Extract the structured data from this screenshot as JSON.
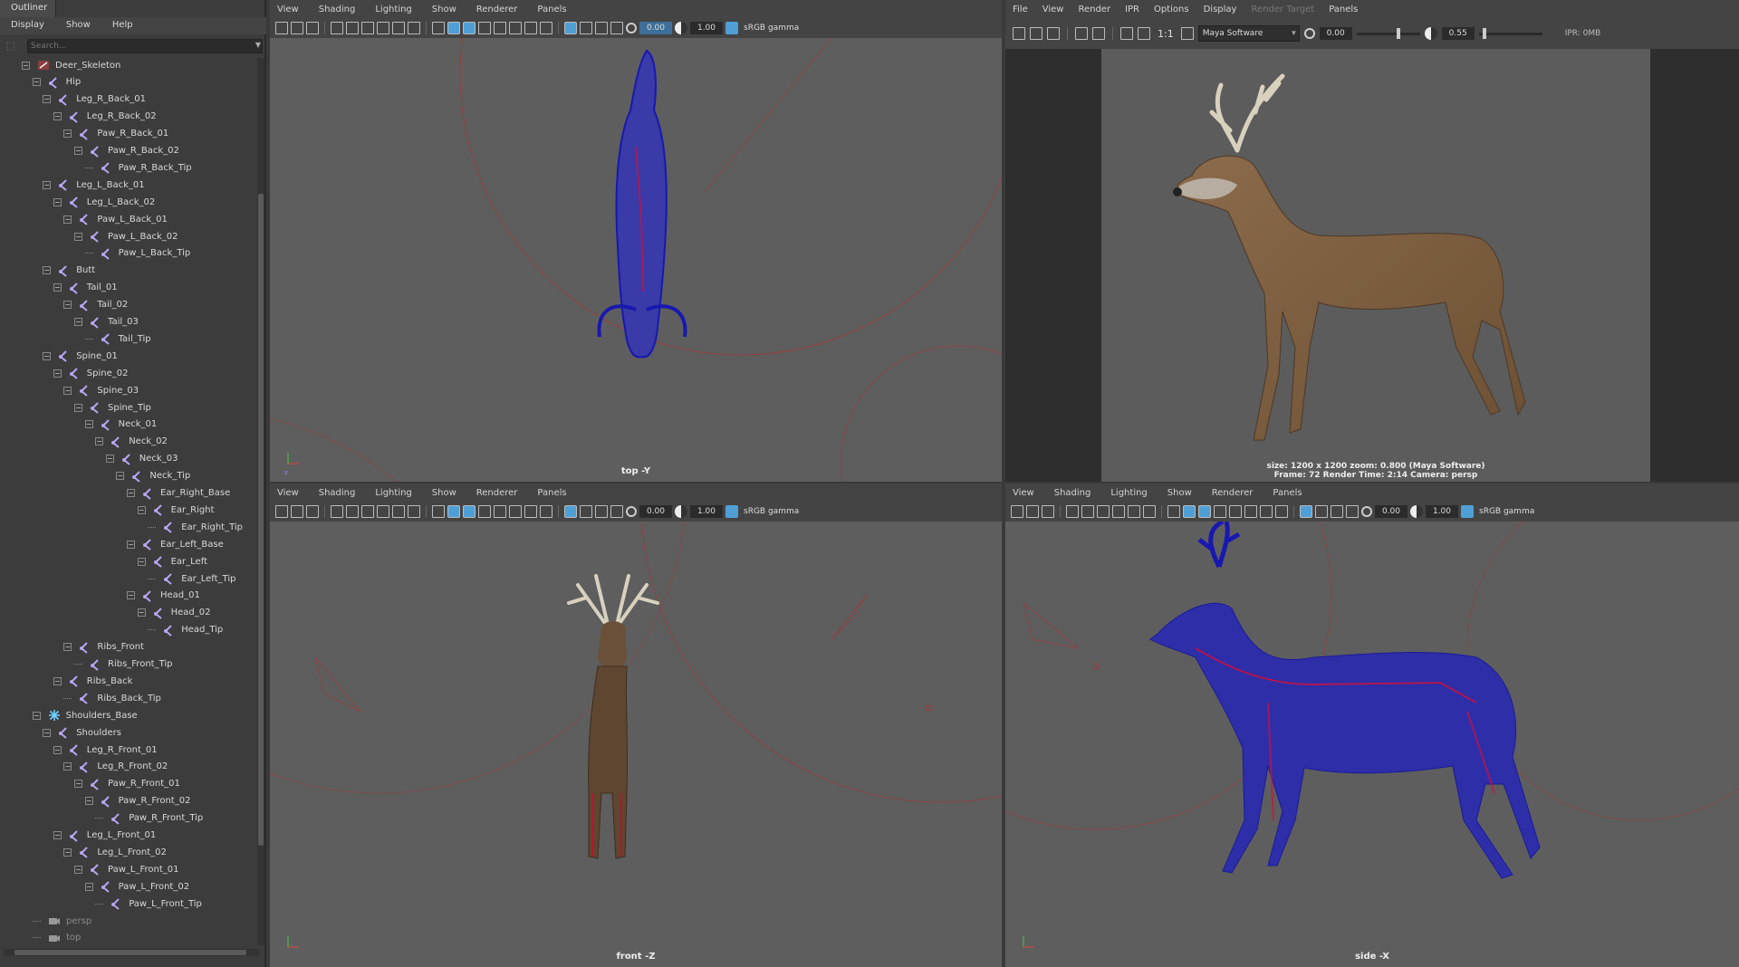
{
  "outliner": {
    "tab": "Outliner",
    "menu": [
      "Display",
      "Show",
      "Help"
    ],
    "search_placeholder": "Search...",
    "items": [
      {
        "label": "Deer_Skeleton",
        "depth": 0,
        "expander": "⊟",
        "icon": "group-icon"
      },
      {
        "label": "Hip",
        "depth": 1,
        "expander": "⊟",
        "icon": "joint-icon"
      },
      {
        "label": "Leg_R_Back_01",
        "depth": 2,
        "expander": "⊟",
        "icon": "joint-icon"
      },
      {
        "label": "Leg_R_Back_02",
        "depth": 3,
        "expander": "⊟",
        "icon": "joint-icon"
      },
      {
        "label": "Paw_R_Back_01",
        "depth": 4,
        "expander": "⊟",
        "icon": "joint-icon"
      },
      {
        "label": "Paw_R_Back_02",
        "depth": 5,
        "expander": "⊟",
        "icon": "joint-icon"
      },
      {
        "label": "Paw_R_Back_Tip",
        "depth": 6,
        "expander": "",
        "icon": "joint-icon"
      },
      {
        "label": "Leg_L_Back_01",
        "depth": 2,
        "expander": "⊟",
        "icon": "joint-icon"
      },
      {
        "label": "Leg_L_Back_02",
        "depth": 3,
        "expander": "⊟",
        "icon": "joint-icon"
      },
      {
        "label": "Paw_L_Back_01",
        "depth": 4,
        "expander": "⊟",
        "icon": "joint-icon"
      },
      {
        "label": "Paw_L_Back_02",
        "depth": 5,
        "expander": "⊟",
        "icon": "joint-icon"
      },
      {
        "label": "Paw_L_Back_Tip",
        "depth": 6,
        "expander": "",
        "icon": "joint-icon"
      },
      {
        "label": "Butt",
        "depth": 2,
        "expander": "⊟",
        "icon": "joint-icon"
      },
      {
        "label": "Tail_01",
        "depth": 3,
        "expander": "⊟",
        "icon": "joint-icon"
      },
      {
        "label": "Tail_02",
        "depth": 4,
        "expander": "⊟",
        "icon": "joint-icon"
      },
      {
        "label": "Tail_03",
        "depth": 5,
        "expander": "⊟",
        "icon": "joint-icon"
      },
      {
        "label": "Tail_Tip",
        "depth": 6,
        "expander": "",
        "icon": "joint-icon"
      },
      {
        "label": "Spine_01",
        "depth": 2,
        "expander": "⊟",
        "icon": "joint-icon"
      },
      {
        "label": "Spine_02",
        "depth": 3,
        "expander": "⊟",
        "icon": "joint-icon"
      },
      {
        "label": "Spine_03",
        "depth": 4,
        "expander": "⊟",
        "icon": "joint-icon"
      },
      {
        "label": "Spine_Tip",
        "depth": 5,
        "expander": "⊟",
        "icon": "joint-icon"
      },
      {
        "label": "Neck_01",
        "depth": 6,
        "expander": "⊟",
        "icon": "joint-icon"
      },
      {
        "label": "Neck_02",
        "depth": 7,
        "expander": "⊟",
        "icon": "joint-icon"
      },
      {
        "label": "Neck_03",
        "depth": 8,
        "expander": "⊟",
        "icon": "joint-icon"
      },
      {
        "label": "Neck_Tip",
        "depth": 9,
        "expander": "⊟",
        "icon": "joint-icon"
      },
      {
        "label": "Ear_Right_Base",
        "depth": 10,
        "expander": "⊟",
        "icon": "joint-icon"
      },
      {
        "label": "Ear_Right",
        "depth": 11,
        "expander": "⊟",
        "icon": "joint-icon"
      },
      {
        "label": "Ear_Right_Tip",
        "depth": 12,
        "expander": "",
        "icon": "joint-icon"
      },
      {
        "label": "Ear_Left_Base",
        "depth": 10,
        "expander": "⊟",
        "icon": "joint-icon"
      },
      {
        "label": "Ear_Left",
        "depth": 11,
        "expander": "⊟",
        "icon": "joint-icon"
      },
      {
        "label": "Ear_Left_Tip",
        "depth": 12,
        "expander": "",
        "icon": "joint-icon"
      },
      {
        "label": "Head_01",
        "depth": 10,
        "expander": "⊟",
        "icon": "joint-icon"
      },
      {
        "label": "Head_02",
        "depth": 11,
        "expander": "⊟",
        "icon": "joint-icon"
      },
      {
        "label": "Head_Tip",
        "depth": 12,
        "expander": "",
        "icon": "joint-icon"
      },
      {
        "label": "Ribs_Front",
        "depth": 4,
        "expander": "⊟",
        "icon": "joint-icon"
      },
      {
        "label": "Ribs_Front_Tip",
        "depth": 5,
        "expander": "",
        "icon": "joint-icon"
      },
      {
        "label": "Ribs_Back",
        "depth": 3,
        "expander": "⊟",
        "icon": "joint-icon"
      },
      {
        "label": "Ribs_Back_Tip",
        "depth": 4,
        "expander": "",
        "icon": "joint-icon"
      },
      {
        "label": "Shoulders_Base",
        "depth": 1,
        "expander": "⊟",
        "icon": "snowflake-icon"
      },
      {
        "label": "Shoulders",
        "depth": 2,
        "expander": "⊟",
        "icon": "joint-icon"
      },
      {
        "label": "Leg_R_Front_01",
        "depth": 3,
        "expander": "⊟",
        "icon": "joint-icon"
      },
      {
        "label": "Leg_R_Front_02",
        "depth": 4,
        "expander": "⊟",
        "icon": "joint-icon"
      },
      {
        "label": "Paw_R_Front_01",
        "depth": 5,
        "expander": "⊟",
        "icon": "joint-icon"
      },
      {
        "label": "Paw_R_Front_02",
        "depth": 6,
        "expander": "⊟",
        "icon": "joint-icon"
      },
      {
        "label": "Paw_R_Front_Tip",
        "depth": 7,
        "expander": "",
        "icon": "joint-icon"
      },
      {
        "label": "Leg_L_Front_01",
        "depth": 3,
        "expander": "⊟",
        "icon": "joint-icon"
      },
      {
        "label": "Leg_L_Front_02",
        "depth": 4,
        "expander": "⊟",
        "icon": "joint-icon"
      },
      {
        "label": "Paw_L_Front_01",
        "depth": 5,
        "expander": "⊟",
        "icon": "joint-icon"
      },
      {
        "label": "Paw_L_Front_02",
        "depth": 6,
        "expander": "⊟",
        "icon": "joint-icon"
      },
      {
        "label": "Paw_L_Front_Tip",
        "depth": 7,
        "expander": "",
        "icon": "joint-icon"
      },
      {
        "label": "persp",
        "depth": 0,
        "expander": "",
        "icon": "camera-icon",
        "dim": true
      },
      {
        "label": "top",
        "depth": 0,
        "expander": "",
        "icon": "camera-icon",
        "dim": true
      }
    ]
  },
  "viewport_menu": [
    "View",
    "Shading",
    "Lighting",
    "Show",
    "Renderer",
    "Panels"
  ],
  "viewport_fields": {
    "exposure": "0.00",
    "gamma": "1.00",
    "colorspace": "sRGB gamma"
  },
  "viewports": {
    "top": {
      "label": "top -Y"
    },
    "front": {
      "label": "front -Z"
    },
    "side": {
      "label": "side -X"
    }
  },
  "render_view": {
    "menu": [
      "File",
      "View",
      "Render",
      "IPR",
      "Options",
      "Display",
      "Render Target",
      "Panels"
    ],
    "ratio": "1:1",
    "renderer": "Maya Software",
    "exposure": "0.00",
    "gamma": "0.55",
    "ipr_mem": "IPR: 0MB",
    "info_line1": "size: 1200 x 1200  zoom: 0.800       (Maya Software)",
    "info_line2": "Frame: 72        Render Time: 2:14        Camera: persp"
  },
  "colors": {
    "wire_blue": "#1a1ab8",
    "joint_red": "#d0103a",
    "accent": "#4f9fd6",
    "viewport_bg": "#5e5e5e",
    "deer_fur": "#7a5a3c"
  }
}
